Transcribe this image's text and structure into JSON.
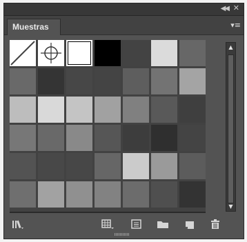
{
  "panel": {
    "tab_label": "Muestras"
  },
  "icons": {
    "collapse": "double-chevron-left-icon",
    "close": "close-icon",
    "menu": "panel-menu-icon"
  },
  "swatches": {
    "rows": [
      [
        "none",
        "registration",
        "#ffffff",
        "#000000",
        "#434343",
        "#dbdbdb",
        "#676767"
      ],
      [
        "#696969",
        "#343434",
        "#474747",
        "#444444",
        "#5e5e5e",
        "#737373",
        "#a4a4a4"
      ],
      [
        "#bdbdbd",
        "#d9d9d9",
        "#c4c4c4",
        "#a1a1a1",
        "#808080",
        "#595959",
        "#3f3f3f"
      ],
      [
        "#777777",
        "#696969",
        "#898989",
        "#565656",
        "#3d3d3d",
        "#2f2f2f",
        "#444444"
      ],
      [
        "#535353",
        "#484848",
        "#474747",
        "#666666",
        "#cbcbcb",
        "#9a9a9a",
        "#5c5c5c"
      ],
      [
        "#6f6f6f",
        "#a2a2a2",
        "#909090",
        "#828282",
        "#6c6c6c",
        "#4f4f4f",
        "#333333"
      ]
    ]
  },
  "toolbar": {
    "buttons": [
      "swatch-libraries-menu",
      "show-swatch-kinds-menu",
      "swatch-options",
      "new-color-group",
      "new-swatch",
      "delete-swatch"
    ]
  }
}
